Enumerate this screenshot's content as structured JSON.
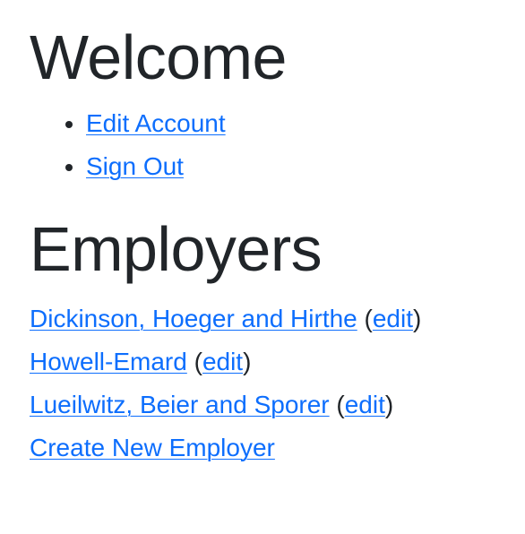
{
  "welcome": {
    "heading": "Welcome",
    "links": [
      {
        "label": "Edit Account"
      },
      {
        "label": "Sign Out"
      }
    ]
  },
  "employers": {
    "heading": "Employers",
    "edit_label": "edit",
    "open_paren": "(",
    "close_paren": ")",
    "items": [
      {
        "name": "Dickinson, Hoeger and Hirthe"
      },
      {
        "name": "Howell-Emard"
      },
      {
        "name": "Lueilwitz, Beier and Sporer"
      }
    ],
    "create_label": "Create New Employer"
  },
  "colors": {
    "link": "#0d6efd",
    "text": "#212529",
    "background": "#ffffff"
  }
}
